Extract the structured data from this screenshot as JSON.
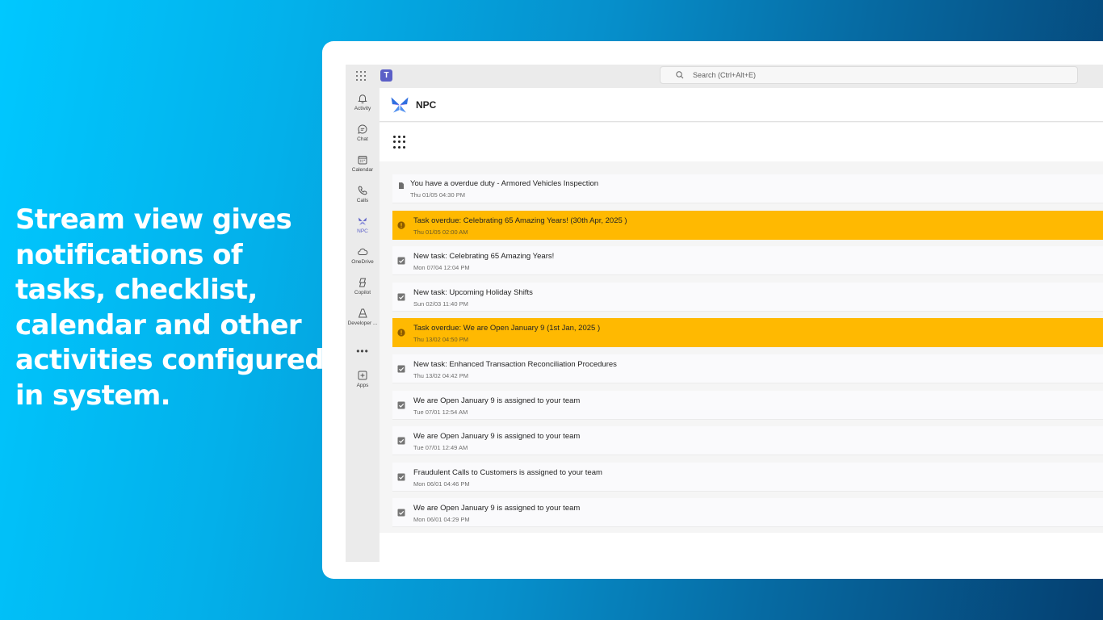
{
  "promo": {
    "text": "Stream view gives notifications of tasks, checklist, calendar and other activities configured in system."
  },
  "topbar": {
    "search_placeholder": "Search (Ctrl+Alt+E)"
  },
  "rail": {
    "items": [
      {
        "label": "Activity",
        "icon": "bell-icon"
      },
      {
        "label": "Chat",
        "icon": "chat-icon"
      },
      {
        "label": "Calendar",
        "icon": "calendar-icon"
      },
      {
        "label": "Calls",
        "icon": "phone-icon"
      },
      {
        "label": "NPC",
        "icon": "npc-app-icon",
        "active": true
      },
      {
        "label": "OneDrive",
        "icon": "cloud-icon"
      },
      {
        "label": "Copilot",
        "icon": "copilot-icon"
      },
      {
        "label": "Developer ...",
        "icon": "developer-portal-icon"
      },
      {
        "label": "Apps",
        "icon": "add-apps-icon"
      }
    ],
    "more": "•••"
  },
  "app": {
    "title": "NPC"
  },
  "feed": [
    {
      "title": "You have a overdue duty - Armored Vehicles Inspection",
      "time": "Thu 01/05 04:30 PM",
      "type": "document"
    },
    {
      "title": "Task overdue: Celebrating 65 Amazing Years! (30th Apr, 2025 )",
      "time": "Thu 01/05 02:00 AM",
      "type": "overdue"
    },
    {
      "title": "New task: Celebrating 65 Amazing Years!",
      "time": "Mon 07/04 12:04 PM",
      "type": "task"
    },
    {
      "title": "New task: Upcoming Holiday Shifts",
      "time": "Sun 02/03 11:40 PM",
      "type": "task"
    },
    {
      "title": "Task overdue: We are Open January 9 (1st Jan, 2025 )",
      "time": "Thu 13/02 04:50 PM",
      "type": "overdue"
    },
    {
      "title": "New task: Enhanced Transaction Reconciliation Procedures",
      "time": "Thu 13/02 04:42 PM",
      "type": "task"
    },
    {
      "title": "We are Open January 9 is assigned to your team",
      "time": "Tue 07/01 12:54 AM",
      "type": "task"
    },
    {
      "title": "We are Open January 9 is assigned to your team",
      "time": "Tue 07/01 12:49 AM",
      "type": "task"
    },
    {
      "title": "Fraudulent Calls to Customers is assigned to your team",
      "time": "Mon 06/01 04:46 PM",
      "type": "task"
    },
    {
      "title": "We are Open January 9 is assigned to your team",
      "time": "Mon 06/01 04:29 PM",
      "type": "task"
    }
  ],
  "colors": {
    "overdue": "#ffb901",
    "teams_accent": "#5b5fc7",
    "npc_logo": "#2f6fe0"
  }
}
